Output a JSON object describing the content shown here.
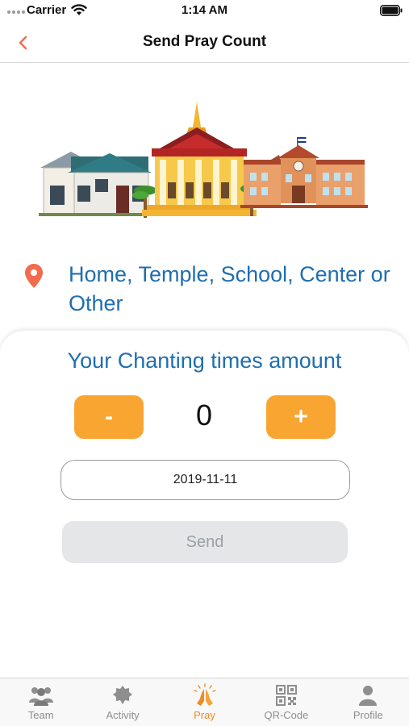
{
  "status_bar": {
    "carrier": "Carrier",
    "time": "1:14 AM"
  },
  "nav": {
    "title": "Send Pray Count",
    "back_icon": "chevron-left-icon"
  },
  "location": {
    "text": "Home, Temple, School, Center or Other",
    "icon": "map-pin-icon",
    "color": "#f26b4f"
  },
  "counter": {
    "title": "Your Chanting times amount",
    "minus_label": "-",
    "plus_label": "+",
    "count": "0"
  },
  "date": {
    "value": "2019-11-11"
  },
  "send": {
    "label": "Send"
  },
  "tabs": [
    {
      "label": "Team",
      "icon": "team-icon",
      "active": false
    },
    {
      "label": "Activity",
      "icon": "activity-icon",
      "active": false
    },
    {
      "label": "Pray",
      "icon": "pray-icon",
      "active": true
    },
    {
      "label": "QR-Code",
      "icon": "qr-code-icon",
      "active": false
    },
    {
      "label": "Profile",
      "icon": "profile-icon",
      "active": false
    }
  ],
  "colors": {
    "accent": "#f9a531",
    "title_blue": "#1f6eb0",
    "active_tab": "#f08a24",
    "disabled_button": "#e5e6e8"
  }
}
